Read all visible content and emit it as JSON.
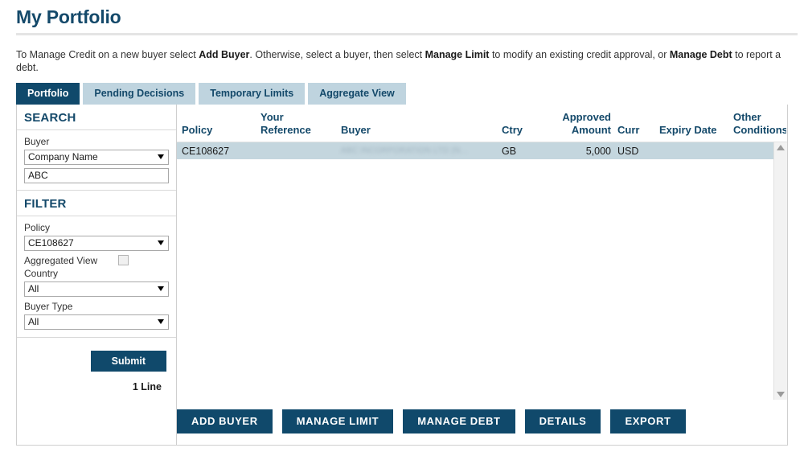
{
  "header": {
    "title": "My Portfolio",
    "intro": {
      "part1": "To Manage Credit on a new buyer select ",
      "bold1": "Add Buyer",
      "part2": ". Otherwise, select a buyer, then select ",
      "bold2": "Manage Limit",
      "part3": " to modify an existing credit approval, or ",
      "bold3": "Manage Debt",
      "part4": " to report a debt."
    }
  },
  "tabs": [
    {
      "label": "Portfolio",
      "active": true
    },
    {
      "label": "Pending Decisions",
      "active": false
    },
    {
      "label": "Temporary Limits",
      "active": false
    },
    {
      "label": "Aggregate View",
      "active": false
    }
  ],
  "sidebar": {
    "search": {
      "heading": "SEARCH",
      "buyer_label": "Buyer",
      "buyer_select_value": "Company Name",
      "buyer_text_value": "ABC"
    },
    "filter": {
      "heading": "FILTER",
      "policy_label": "Policy",
      "policy_value": "CE108627",
      "aggregated_view_label": "Aggregated View",
      "aggregated_view_checked": false,
      "country_label": "Country",
      "country_value": "All",
      "buyer_type_label": "Buyer Type",
      "buyer_type_value": "All"
    },
    "submit_label": "Submit",
    "line_count": "1 Line"
  },
  "table": {
    "columns": [
      {
        "key": "policy",
        "label": "Policy"
      },
      {
        "key": "yourref",
        "label": "Your Reference"
      },
      {
        "key": "buyer",
        "label": "Buyer"
      },
      {
        "key": "ctry",
        "label": "Ctry"
      },
      {
        "key": "approved",
        "label": "Approved Amount"
      },
      {
        "key": "curr",
        "label": "Curr"
      },
      {
        "key": "expiry",
        "label": "Expiry Date"
      },
      {
        "key": "other",
        "label": "Other Conditions"
      }
    ],
    "header_lines": {
      "policy": "Policy",
      "yourref_l1": "Your",
      "yourref_l2": "Reference",
      "buyer": "Buyer",
      "ctry": "Ctry",
      "approved_l1": "Approved",
      "approved_l2": "Amount",
      "curr": "Curr",
      "expiry": "Expiry Date",
      "other_l1": "Other",
      "other_l2": "Conditions"
    },
    "rows": [
      {
        "policy": "CE108627",
        "yourref": "",
        "buyer": "ABC INCORPORATION LTD (N...",
        "ctry": "GB",
        "approved": "5,000",
        "curr": "USD",
        "expiry": "",
        "other": "",
        "selected": true
      }
    ]
  },
  "actions": [
    {
      "label": "ADD BUYER",
      "name": "add-buyer-button"
    },
    {
      "label": "MANAGE LIMIT",
      "name": "manage-limit-button"
    },
    {
      "label": "MANAGE DEBT",
      "name": "manage-debt-button"
    },
    {
      "label": "DETAILS",
      "name": "details-button"
    },
    {
      "label": "EXPORT",
      "name": "export-button"
    }
  ],
  "colors": {
    "brand_navy": "#10496b",
    "heading_navy": "#14496a",
    "tab_inactive": "#bfd4df",
    "row_selected": "#c4d6de"
  }
}
